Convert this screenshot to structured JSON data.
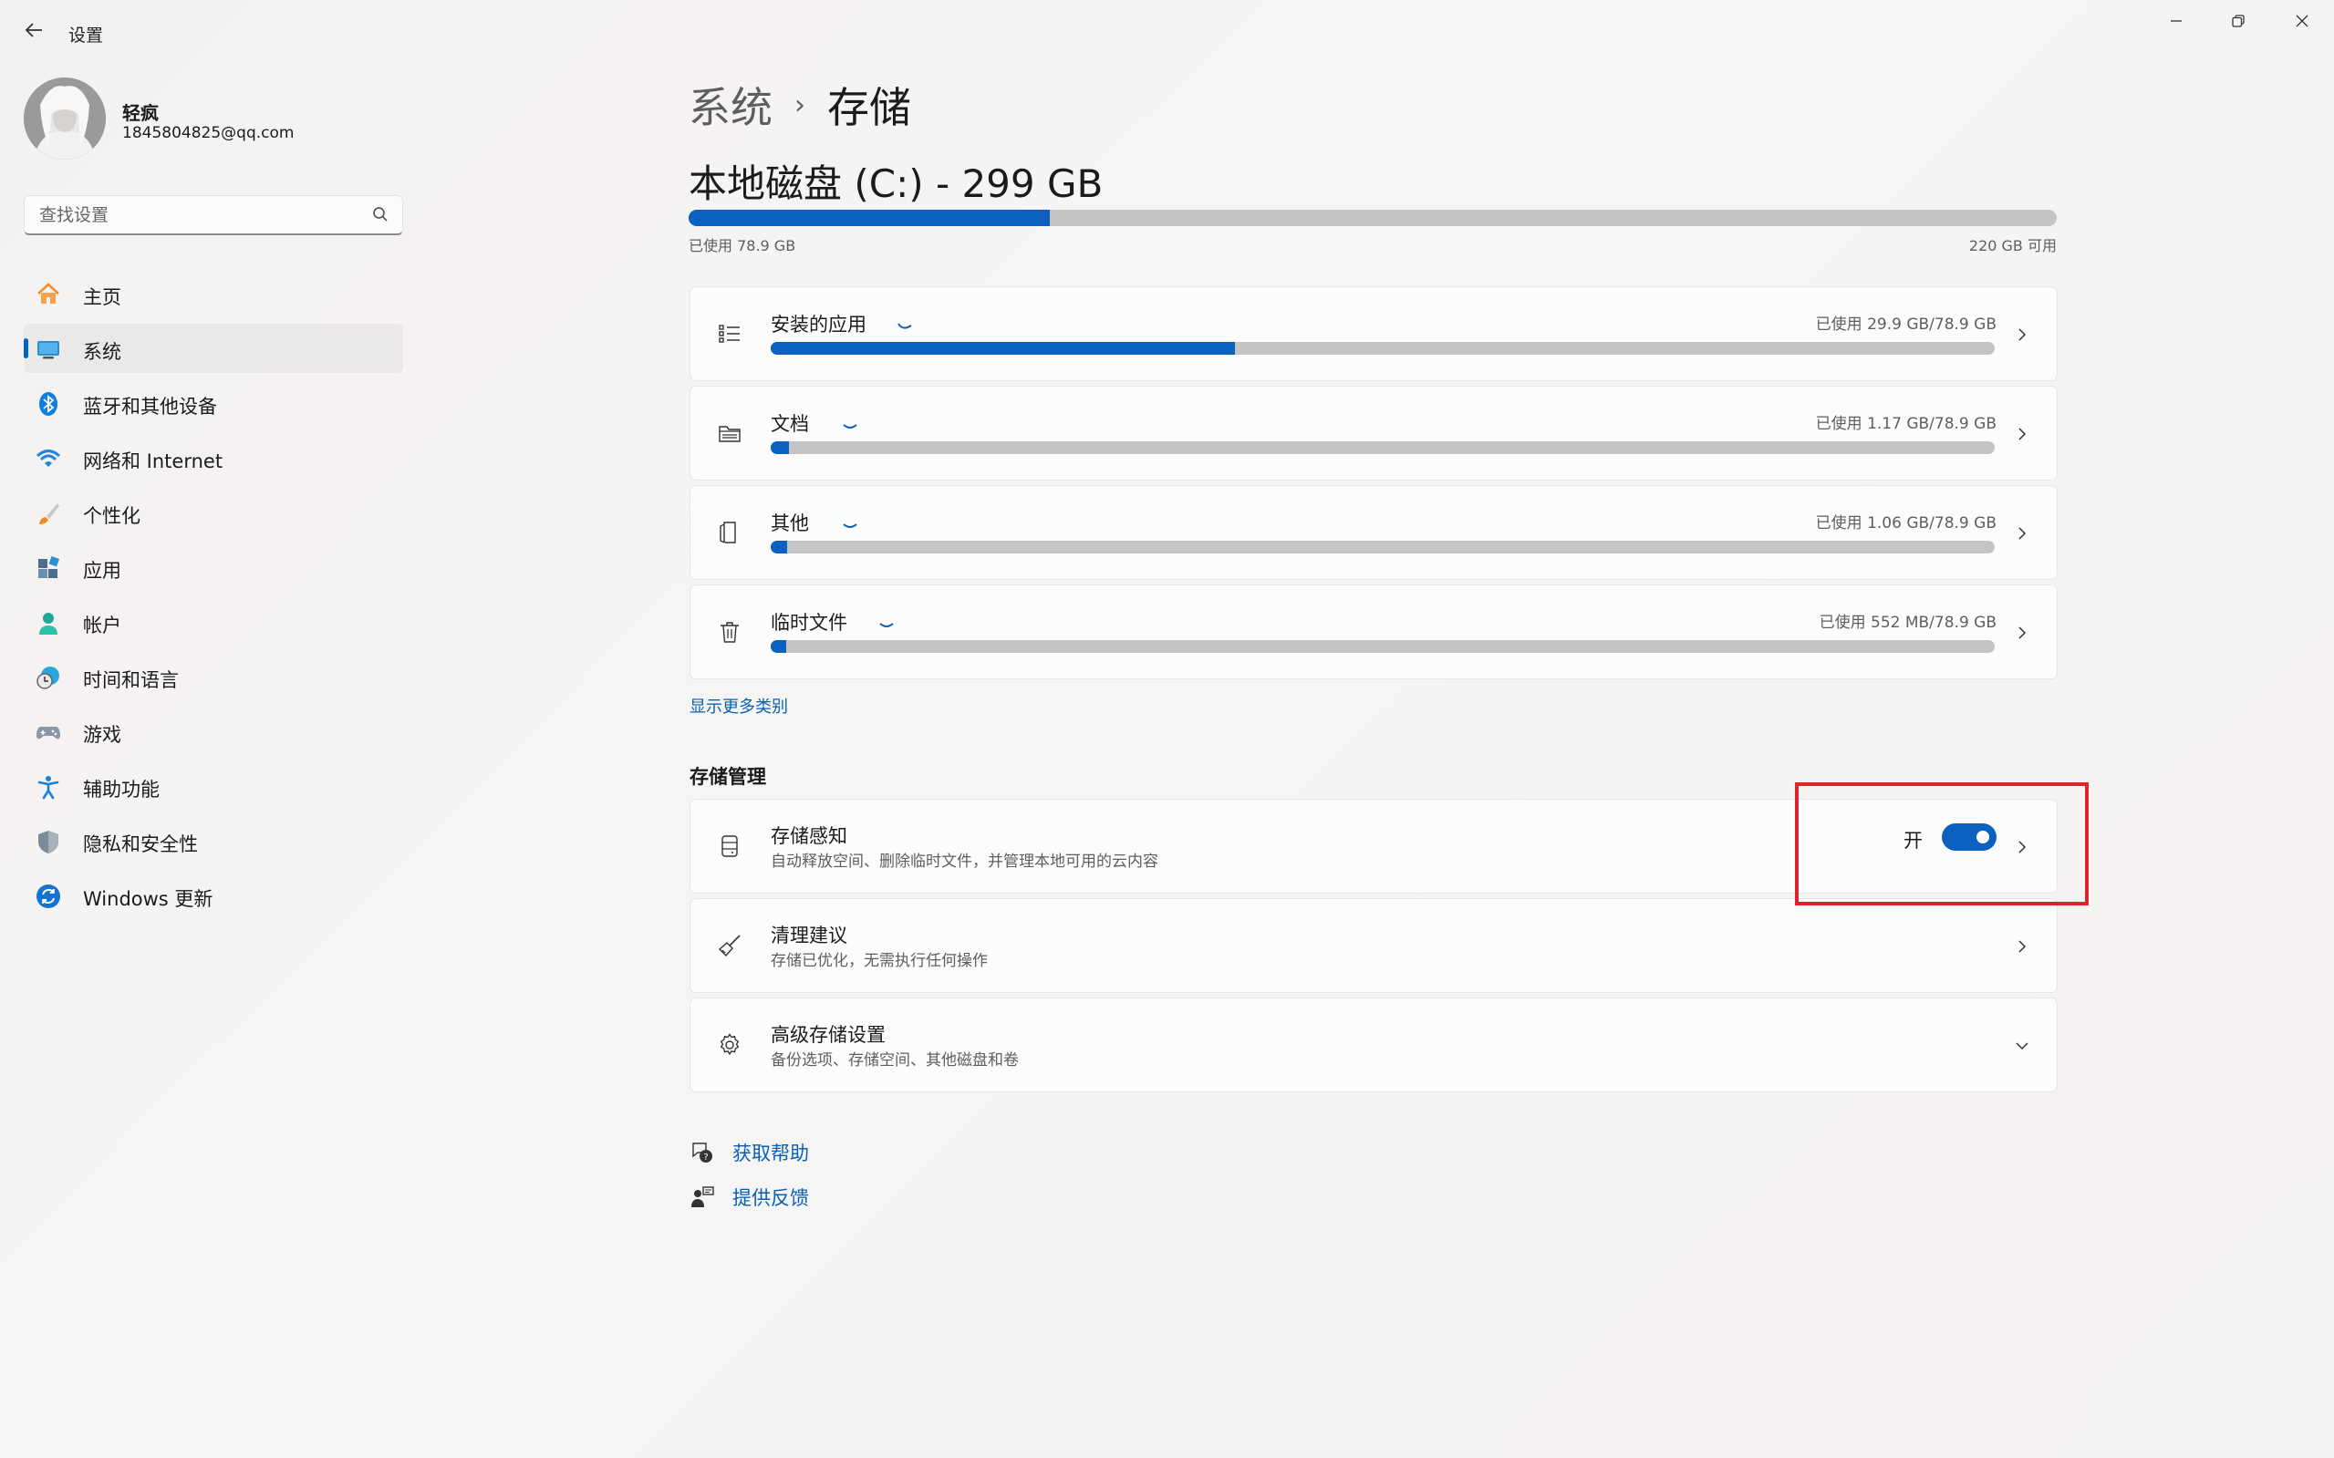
{
  "window": {
    "title": "设置",
    "controls": {
      "minimize": "minimize-icon",
      "restore": "restore-icon",
      "close": "close-icon"
    }
  },
  "user": {
    "name": "轻疯",
    "email": "1845804825@qq.com"
  },
  "search": {
    "placeholder": "查找设置"
  },
  "sidebar": {
    "items": [
      {
        "label": "主页",
        "icon": "home-icon",
        "active": false
      },
      {
        "label": "系统",
        "icon": "system-icon",
        "active": true
      },
      {
        "label": "蓝牙和其他设备",
        "icon": "bluetooth-icon",
        "active": false
      },
      {
        "label": "网络和 Internet",
        "icon": "wifi-icon",
        "active": false
      },
      {
        "label": "个性化",
        "icon": "brush-icon",
        "active": false
      },
      {
        "label": "应用",
        "icon": "apps-icon",
        "active": false
      },
      {
        "label": "帐户",
        "icon": "account-icon",
        "active": false
      },
      {
        "label": "时间和语言",
        "icon": "time-language-icon",
        "active": false
      },
      {
        "label": "游戏",
        "icon": "gamepad-icon",
        "active": false
      },
      {
        "label": "辅助功能",
        "icon": "accessibility-icon",
        "active": false
      },
      {
        "label": "隐私和安全性",
        "icon": "shield-icon",
        "active": false
      },
      {
        "label": "Windows 更新",
        "icon": "update-icon",
        "active": false
      }
    ]
  },
  "breadcrumb": {
    "parent": "系统",
    "separator": "›",
    "current": "存储"
  },
  "disk": {
    "title": "本地磁盘 (C:) - 299 GB",
    "used_label": "已使用 78.9 GB",
    "free_label": "220 GB 可用",
    "used_fraction": 0.264
  },
  "categories": [
    {
      "label": "安装的应用",
      "usage": "已使用 29.9 GB/78.9 GB",
      "fraction": 0.379,
      "icon": "list-icon"
    },
    {
      "label": "文档",
      "usage": "已使用 1.17 GB/78.9 GB",
      "fraction": 0.0148,
      "icon": "folder-icon"
    },
    {
      "label": "其他",
      "usage": "已使用 1.06 GB/78.9 GB",
      "fraction": 0.0134,
      "icon": "other-files-icon"
    },
    {
      "label": "临时文件",
      "usage": "已使用 552 MB/78.9 GB",
      "fraction": 0.0068,
      "icon": "trash-icon"
    }
  ],
  "show_more": "显示更多类别",
  "storage_management": {
    "title": "存储管理",
    "items": [
      {
        "label": "存储感知",
        "desc": "自动释放空间、删除临时文件，并管理本地可用的云内容",
        "toggle_text": "开",
        "toggle_on": true,
        "icon": "storage-sense-icon"
      },
      {
        "label": "清理建议",
        "desc": "存储已优化，无需执行任何操作",
        "icon": "broom-icon"
      },
      {
        "label": "高级存储设置",
        "desc": "备份选项、存储空间、其他磁盘和卷",
        "icon": "gear-icon"
      }
    ]
  },
  "help": {
    "get_help": "获取帮助",
    "feedback": "提供反馈"
  },
  "colors": {
    "accent": "#0c61c0",
    "highlight": "#e0222a"
  }
}
